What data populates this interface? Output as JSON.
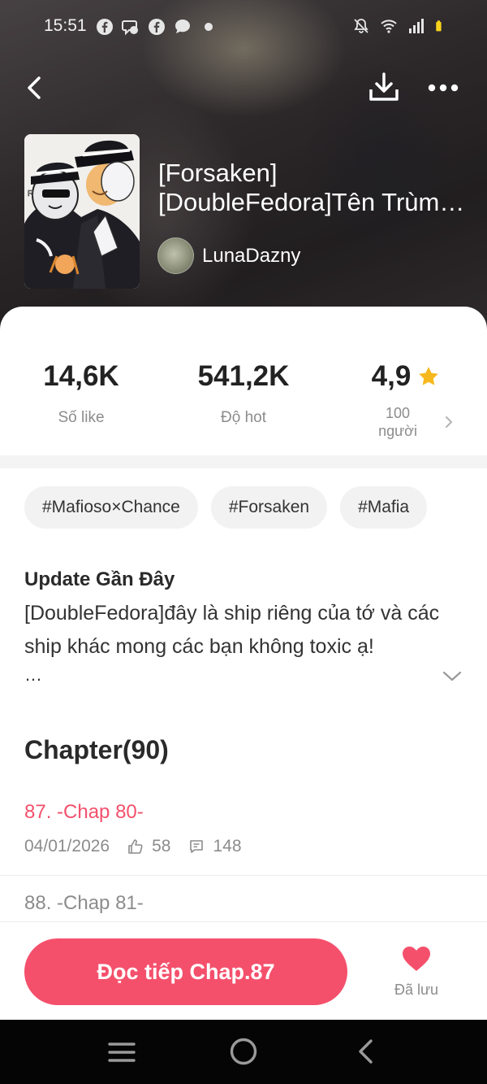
{
  "status_bar": {
    "time": "15:51",
    "left_icons": [
      "facebook-icon",
      "messenger-icon",
      "facebook-icon",
      "chat-bubble-icon",
      "dot-icon"
    ],
    "right_icons": [
      "mute-icon",
      "wifi-icon",
      "signal-icon",
      "battery-icon"
    ]
  },
  "header": {
    "title_line1": "[Forsaken]",
    "title_line2": "[DoubleFedora]Tên Trùm Nhà Mafia",
    "author": "LunaDazny"
  },
  "stats": {
    "likes_value": "14,6K",
    "likes_label": "Số like",
    "hot_value": "541,2K",
    "hot_label": "Độ hot",
    "rating_value": "4,9",
    "rating_count": "100",
    "rating_count_unit": "người"
  },
  "tags": [
    "#Mafioso×Chance",
    "#Forsaken",
    "#Mafia"
  ],
  "update": {
    "title": "Update Gần Đây",
    "text": "[DoubleFedora]đây là ship riêng của tớ và các ship khác mong các bạn không toxic ạ!",
    "ellipsis": "…"
  },
  "chapters": {
    "heading": "Chapter(90)",
    "items": [
      {
        "title": "87. -Chap 80-",
        "date": "04/01/2026",
        "likes": "58",
        "comments": "148",
        "state": "current"
      },
      {
        "title": "88. -Chap 81-",
        "state": "unread"
      }
    ]
  },
  "bottom": {
    "read_button": "Đọc tiếp Chap.87",
    "saved_label": "Đã lưu"
  },
  "colors": {
    "accent": "#f4506c",
    "star": "#f6b81c",
    "muted_text": "#8c8c8c"
  }
}
